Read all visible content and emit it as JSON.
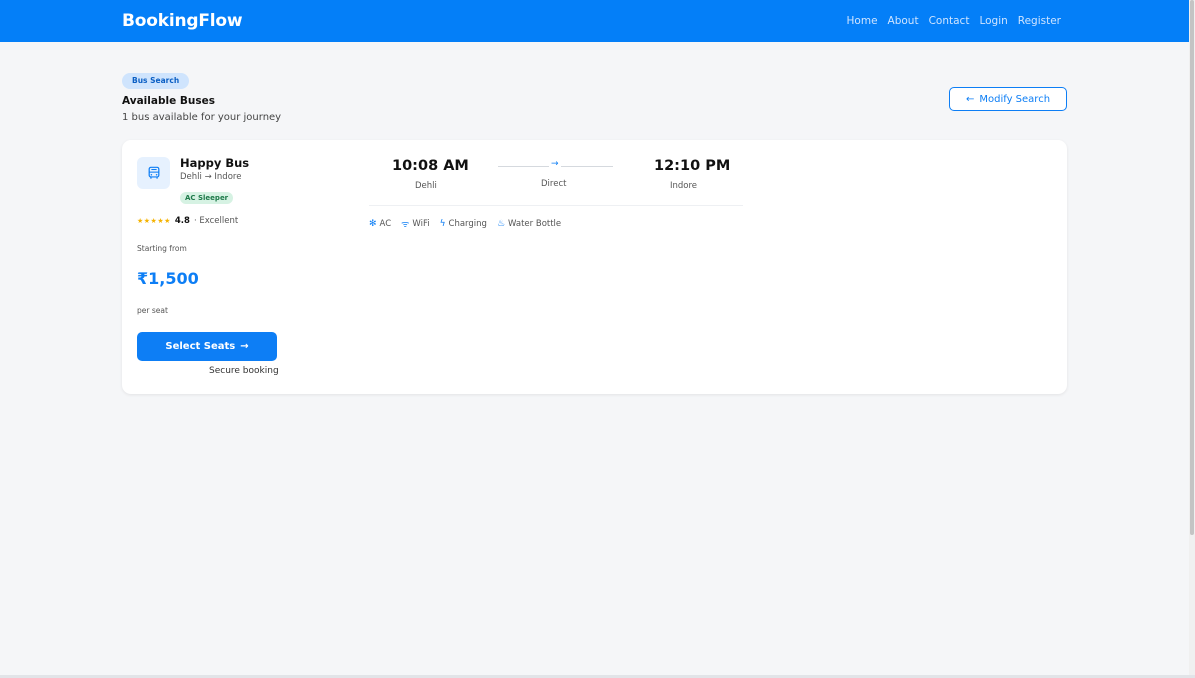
{
  "navbar": {
    "brand": "BookingFlow",
    "links": [
      "Home",
      "About",
      "Contact",
      "Login",
      "Register"
    ],
    "bg_color": "#047ff8"
  },
  "header": {
    "pill": "Bus Search",
    "title": "Available Buses",
    "subtitle": "1 bus available for your journey",
    "modify_button": "Modify Search",
    "modify_icon": "arrow-left-icon"
  },
  "bus": {
    "name": "Happy Bus",
    "route": "Dehli → Indore",
    "type": "AC Sleeper",
    "stars": "★★★★★",
    "rating": "4.8",
    "rating_label": "· Excellent",
    "starting_from": "Starting from",
    "price": "₹1,500",
    "per_seat": "per seat",
    "select_button": "Select Seats",
    "select_icon": "arrow-right-icon",
    "secure": "Secure booking",
    "departure": {
      "time": "10:08 AM",
      "city": "Dehli"
    },
    "arrival": {
      "time": "12:10 PM",
      "city": "Indore"
    },
    "route_type": "Direct",
    "route_arrow": "→",
    "amenities": [
      {
        "icon": "snowflake-icon",
        "glyph": "✻",
        "label": "AC"
      },
      {
        "icon": "wifi-icon",
        "glyph": "ᯤ",
        "label": "WiFi"
      },
      {
        "icon": "lightning-icon",
        "glyph": "ϟ",
        "label": "Charging"
      },
      {
        "icon": "bottle-icon",
        "glyph": "♨",
        "label": "Water Bottle"
      }
    ]
  },
  "colors": {
    "accent": "#0d7ef5",
    "badge_green_bg": "#d6f2e3",
    "badge_green_text": "#1e7a4a",
    "star": "#f5b301"
  }
}
